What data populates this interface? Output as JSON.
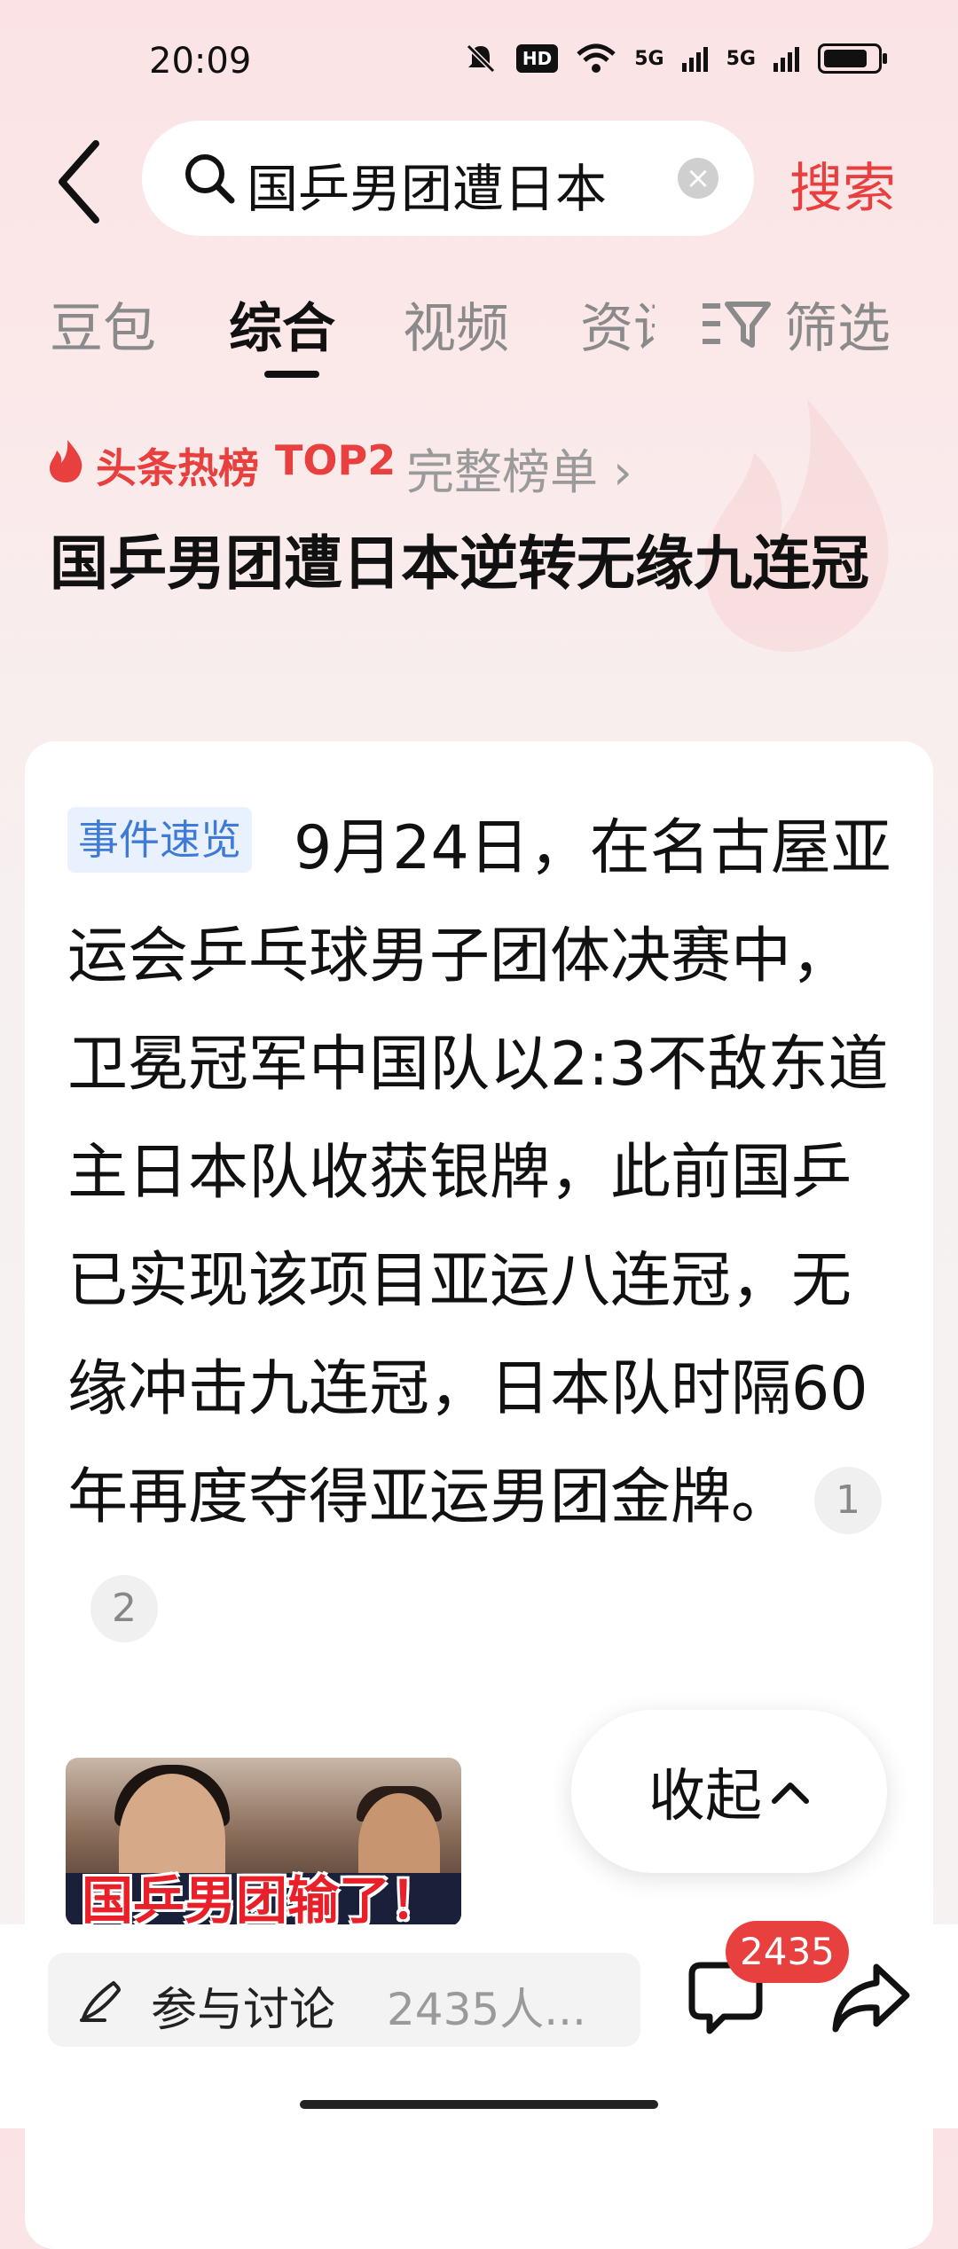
{
  "status": {
    "time": "20:09",
    "hd": "HD",
    "sig1": "5G",
    "sig2": "5G",
    "battery_level": 0.85
  },
  "search": {
    "query": "国乒男团遭日本",
    "button": "搜索"
  },
  "tabs": [
    {
      "label": "豆包"
    },
    {
      "label": "综合",
      "active": true
    },
    {
      "label": "视频"
    },
    {
      "label": "资讯"
    }
  ],
  "filter": {
    "label": "筛选"
  },
  "hot": {
    "label": "头条热榜",
    "rank": "TOP2",
    "more": "完整榜单 ›"
  },
  "headline": "国乒男团遭日本逆转无缘九连冠",
  "card": {
    "badge": "事件速览",
    "summary": "9月24日，在名古屋亚运会乒乓球男子团体决赛中，卫冕冠军中国队以2:3不敌东道主日本队收获银牌，此前国乒已实现该项目亚运八连冠，无缘冲击九连冠，日本队时隔60年再度夺得亚运男团金牌。",
    "citations": [
      "1",
      "2"
    ],
    "thumb_caption": "国乒男团输了！",
    "collapse": "收起"
  },
  "bottom": {
    "discuss_label": "参与讨论",
    "discuss_count": "2435人...",
    "comment_count": "2435"
  },
  "colors": {
    "accent": "#e8403f",
    "badge_bg": "#e8f1fd",
    "badge_text": "#3f7ad6"
  }
}
